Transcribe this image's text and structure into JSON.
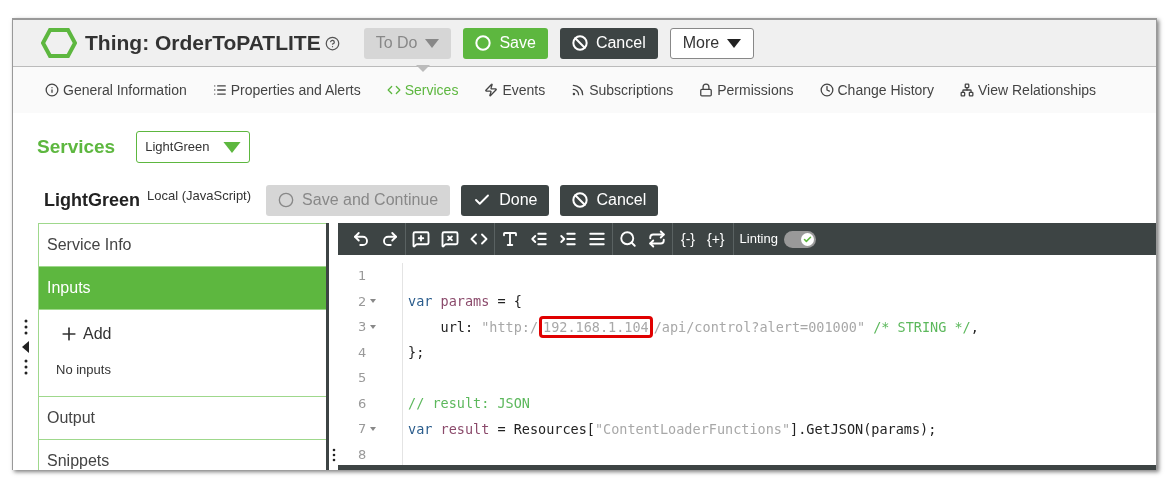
{
  "header": {
    "title": "Thing: OrderToPATLITE",
    "state_button": {
      "label": "To Do",
      "disabled": true
    },
    "buttons": [
      {
        "label": "Save",
        "kind": "primary"
      },
      {
        "label": "Cancel",
        "kind": "dark"
      },
      {
        "label": "More",
        "kind": "menu"
      }
    ]
  },
  "tabs": [
    {
      "label": "General Information",
      "selected": false
    },
    {
      "label": "Properties and Alerts",
      "selected": false
    },
    {
      "label": "Services",
      "selected": true
    },
    {
      "label": "Events",
      "selected": false
    },
    {
      "label": "Subscriptions",
      "selected": false
    },
    {
      "label": "Permissions",
      "selected": false
    },
    {
      "label": "Change History",
      "selected": false
    },
    {
      "label": "View Relationships",
      "selected": false
    }
  ],
  "services": {
    "heading": "Services",
    "dropdown_value": "LightGreen"
  },
  "service": {
    "name": "LightGreen",
    "type": "Local (JavaScript)",
    "buttons": [
      {
        "label": "Save and Continue",
        "kind": "disabled"
      },
      {
        "label": "Done",
        "kind": "dark"
      },
      {
        "label": "Cancel",
        "kind": "dark"
      }
    ]
  },
  "sections": [
    {
      "label": "Service Info",
      "selected": false
    },
    {
      "label": "Inputs",
      "selected": true,
      "add_label": "Add",
      "empty_text": "No inputs"
    },
    {
      "label": "Output",
      "selected": false
    },
    {
      "label": "Snippets",
      "selected": false
    }
  ],
  "editor": {
    "toolbar": {
      "braces": [
        "{-}",
        "{+}"
      ],
      "linting": {
        "label": "Linting",
        "on": true
      }
    },
    "lines": [
      {
        "number": "1",
        "foldable": false
      },
      {
        "number": "2",
        "foldable": true,
        "tokens": [
          {
            "kind": "keyword",
            "text": "var"
          },
          {
            "kind": "variable",
            "text": " params"
          },
          {
            "kind": "plain",
            "text": " = {"
          }
        ]
      },
      {
        "number": "3",
        "foldable": true,
        "tokens": [
          {
            "kind": "plain",
            "text": "    url: "
          },
          {
            "kind": "string",
            "text": "\"http:/"
          },
          {
            "kind": "marked",
            "text": "192.168.1.104"
          },
          {
            "kind": "string",
            "text": "/api/control?alert=001000\""
          },
          {
            "kind": "comment",
            "text": " /* STRING */"
          },
          {
            "kind": "plain",
            "text": ","
          }
        ]
      },
      {
        "number": "4",
        "foldable": false,
        "tokens": [
          {
            "kind": "plain",
            "text": "};"
          }
        ]
      },
      {
        "number": "5",
        "foldable": false
      },
      {
        "number": "6",
        "foldable": false,
        "tokens": [
          {
            "kind": "comment",
            "text": "// result: JSON"
          }
        ]
      },
      {
        "number": "7",
        "foldable": true,
        "tokens": [
          {
            "kind": "keyword",
            "text": "var"
          },
          {
            "kind": "variable",
            "text": " result"
          },
          {
            "kind": "plain",
            "text": " = Resources["
          },
          {
            "kind": "string",
            "text": "\"ContentLoaderFunctions\""
          },
          {
            "kind": "plain",
            "text": "].GetJSON(params);"
          }
        ]
      },
      {
        "number": "8",
        "foldable": false
      }
    ]
  }
}
